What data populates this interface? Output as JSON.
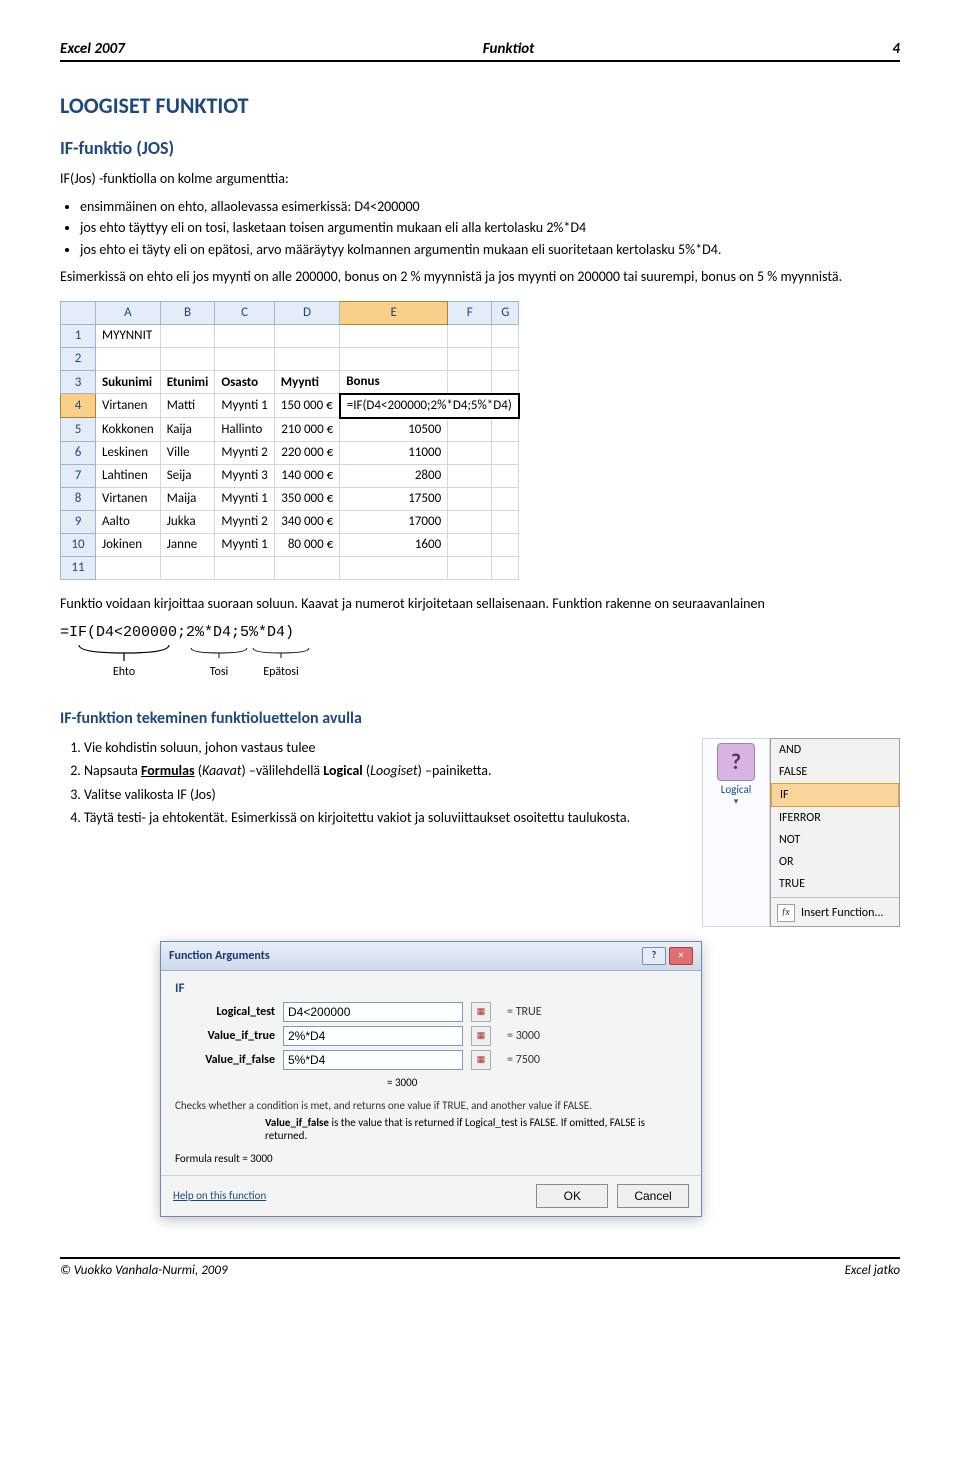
{
  "header": {
    "left": "Excel 2007",
    "center": "Funktiot",
    "right": "4"
  },
  "h1": "LOOGISET FUNKTIOT",
  "h2": "IF-funktio (JOS)",
  "intro": "IF(Jos) -funktiolla on kolme argumenttia:",
  "bullets": [
    "ensimmäinen on ehto, allaolevassa esimerkissä: D4<200000",
    "jos ehto täyttyy eli on tosi, lasketaan toisen argumentin mukaan eli alla kertolasku 2%*D4",
    "jos ehto ei täyty eli on epätosi, arvo määräytyy kolmannen argumentin mukaan eli suoritetaan kertolasku 5%*D4."
  ],
  "after_bullets": "Esimerkissä on ehto eli jos myynti on alle 200000, bonus on 2 % myynnistä ja jos myynti on 200000 tai suurempi, bonus on 5 % myynnistä.",
  "grid": {
    "cols": [
      "",
      "A",
      "B",
      "C",
      "D",
      "E",
      "F",
      "G"
    ],
    "title_cell": "MYYNNIT",
    "headers": [
      "Sukunimi",
      "Etunimi",
      "Osasto",
      "Myynti",
      "Bonus"
    ],
    "rows": [
      {
        "r": 4,
        "cells": [
          "Virtanen",
          "Matti",
          "Myynti 1",
          "150 000 €",
          "=IF(D4<200000;2%*D4;5%*D4)"
        ],
        "selected": true
      },
      {
        "r": 5,
        "cells": [
          "Kokkonen",
          "Kaija",
          "Hallinto",
          "210 000 €",
          "10500"
        ]
      },
      {
        "r": 6,
        "cells": [
          "Leskinen",
          "Ville",
          "Myynti 2",
          "220 000 €",
          "11000"
        ]
      },
      {
        "r": 7,
        "cells": [
          "Lahtinen",
          "Seija",
          "Myynti 3",
          "140 000 €",
          "2800"
        ]
      },
      {
        "r": 8,
        "cells": [
          "Virtanen",
          "Maija",
          "Myynti 1",
          "350 000 €",
          "17500"
        ]
      },
      {
        "r": 9,
        "cells": [
          "Aalto",
          "Jukka",
          "Myynti 2",
          "340 000 €",
          "17000"
        ]
      },
      {
        "r": 10,
        "cells": [
          "Jokinen",
          "Janne",
          "Myynti 1",
          "80 000 €",
          "1600"
        ]
      }
    ]
  },
  "para2a": "Funktio voidaan kirjoittaa suoraan soluun. Kaavat ja numerot kirjoitetaan sellaisenaan. Funktion rakenne on seuraavanlainen",
  "formula": "=IF(D4<200000;2%*D4;5%*D4)",
  "labels": {
    "a": "Ehto",
    "b": "Tosi",
    "c": "Epätosi"
  },
  "h3": "IF-funktion tekeminen funktioluettelon avulla",
  "steps": [
    {
      "pre": "Vie kohdistin soluun, johon vastaus tulee"
    },
    {
      "pre": "Napsauta ",
      "linkword": "Formulas",
      "paren1": "Kaavat",
      "mid": " –välilehdellä ",
      "bold": "Logical",
      "paren2": "Loogiset",
      "post": " –painiketta."
    },
    {
      "pre": "Valitse valikosta  IF (Jos)"
    },
    {
      "pre": "Täytä testi- ja ehtokentät. Esimerkissä on kirjoitettu vakiot ja soluviittaukset osoitettu taulukosta."
    }
  ],
  "logical_btn": {
    "label": "Logical"
  },
  "menu": {
    "items": [
      "AND",
      "FALSE",
      "IF",
      "IFERROR",
      "NOT",
      "OR",
      "TRUE"
    ],
    "selected": "IF",
    "insert": "Insert Function..."
  },
  "dialog": {
    "title": "Function Arguments",
    "fn": "IF",
    "args": [
      {
        "label": "Logical_test",
        "value": "D4<200000",
        "eq": "= TRUE"
      },
      {
        "label": "Value_if_true",
        "value": "2%*D4",
        "eq": "= 3000"
      },
      {
        "label": "Value_if_false",
        "value": "5%*D4",
        "eq": "= 7500"
      }
    ],
    "eqline": "= 3000",
    "desc1": "Checks whether a condition is met, and returns one value if TRUE, and another value if FALSE.",
    "desc2_label": "Value_if_false",
    "desc2_text": " is the value that is returned if Logical_test is FALSE. If omitted, FALSE is returned.",
    "result_label": "Formula result = ",
    "result_value": "3000",
    "help": "Help on this function",
    "ok": "OK",
    "cancel": "Cancel"
  },
  "footer": {
    "left": "© Vuokko Vanhala-Nurmi, 2009",
    "right": "Excel jatko"
  }
}
